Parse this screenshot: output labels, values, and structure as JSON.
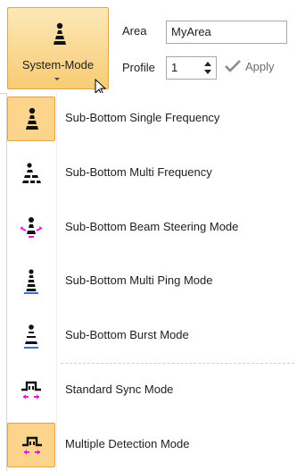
{
  "ribbon": {
    "mode_button_label": "System-Mode",
    "area_label": "Area",
    "area_value": "MyArea",
    "profile_label": "Profile",
    "profile_value": "1",
    "apply_label": "Apply"
  },
  "menu": {
    "items": [
      {
        "label": "Sub-Bottom Single Frequency",
        "icon": "single-frequency-icon",
        "checked": true
      },
      {
        "label": "Sub-Bottom Multi Frequency",
        "icon": "multi-frequency-icon",
        "checked": false
      },
      {
        "label": "Sub-Bottom Beam Steering Mode",
        "icon": "beam-steering-icon",
        "checked": false
      },
      {
        "label": "Sub-Bottom Multi Ping Mode",
        "icon": "multi-ping-icon",
        "checked": false
      },
      {
        "label": "Sub-Bottom Burst Mode",
        "icon": "burst-mode-icon",
        "checked": false
      },
      {
        "label": "Standard Sync Mode",
        "icon": "standard-sync-icon",
        "checked": false
      },
      {
        "label": "Multiple Detection Mode",
        "icon": "multiple-detection-icon",
        "checked": true
      }
    ]
  },
  "colors": {
    "selection_fill": "#fdd48c",
    "selection_border": "#e8a33b",
    "accent_magenta": "#e41ad8",
    "accent_blue": "#3a6fd8"
  }
}
